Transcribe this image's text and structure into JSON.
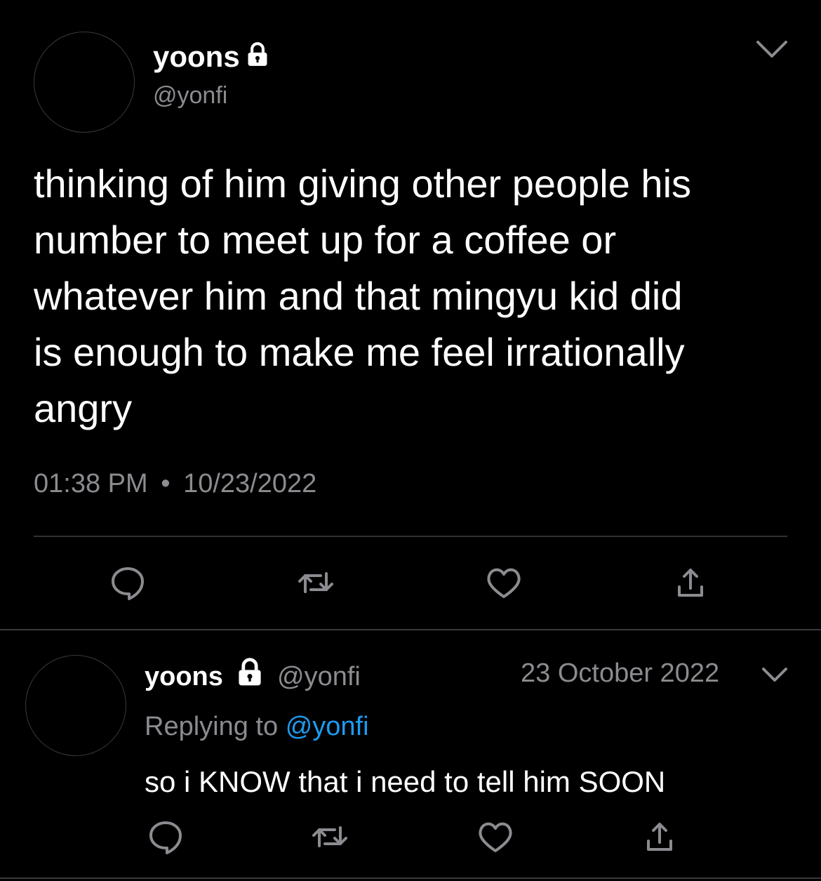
{
  "main_tweet": {
    "display_name": "yoons",
    "handle": "@yonfi",
    "text_lines": [
      "thinking of him giving other people his",
      "number to meet up for a coffee or",
      "whatever him and that mingyu kid did",
      "is enough to make me feel irrationally",
      "angry"
    ],
    "time": "01:38 PM",
    "separator": "•",
    "date": "10/23/2022",
    "actions": [
      "reply-icon",
      "retweet-icon",
      "like-icon",
      "share-icon"
    ]
  },
  "reply_tweet": {
    "display_name": "yoons",
    "handle": "@yonfi",
    "date": "23 October 2022",
    "replying_prefix": "Replying to",
    "replying_handle": "@yonfi",
    "text": "so i KNOW that i need to tell him SOON",
    "actions": [
      "reply-icon",
      "retweet-icon",
      "like-icon",
      "share-icon"
    ]
  },
  "colors": {
    "background": "#000000",
    "text": "#ffffff",
    "muted": "#8b8b90",
    "link": "#1d9bf0",
    "divider": "#2f3336"
  }
}
